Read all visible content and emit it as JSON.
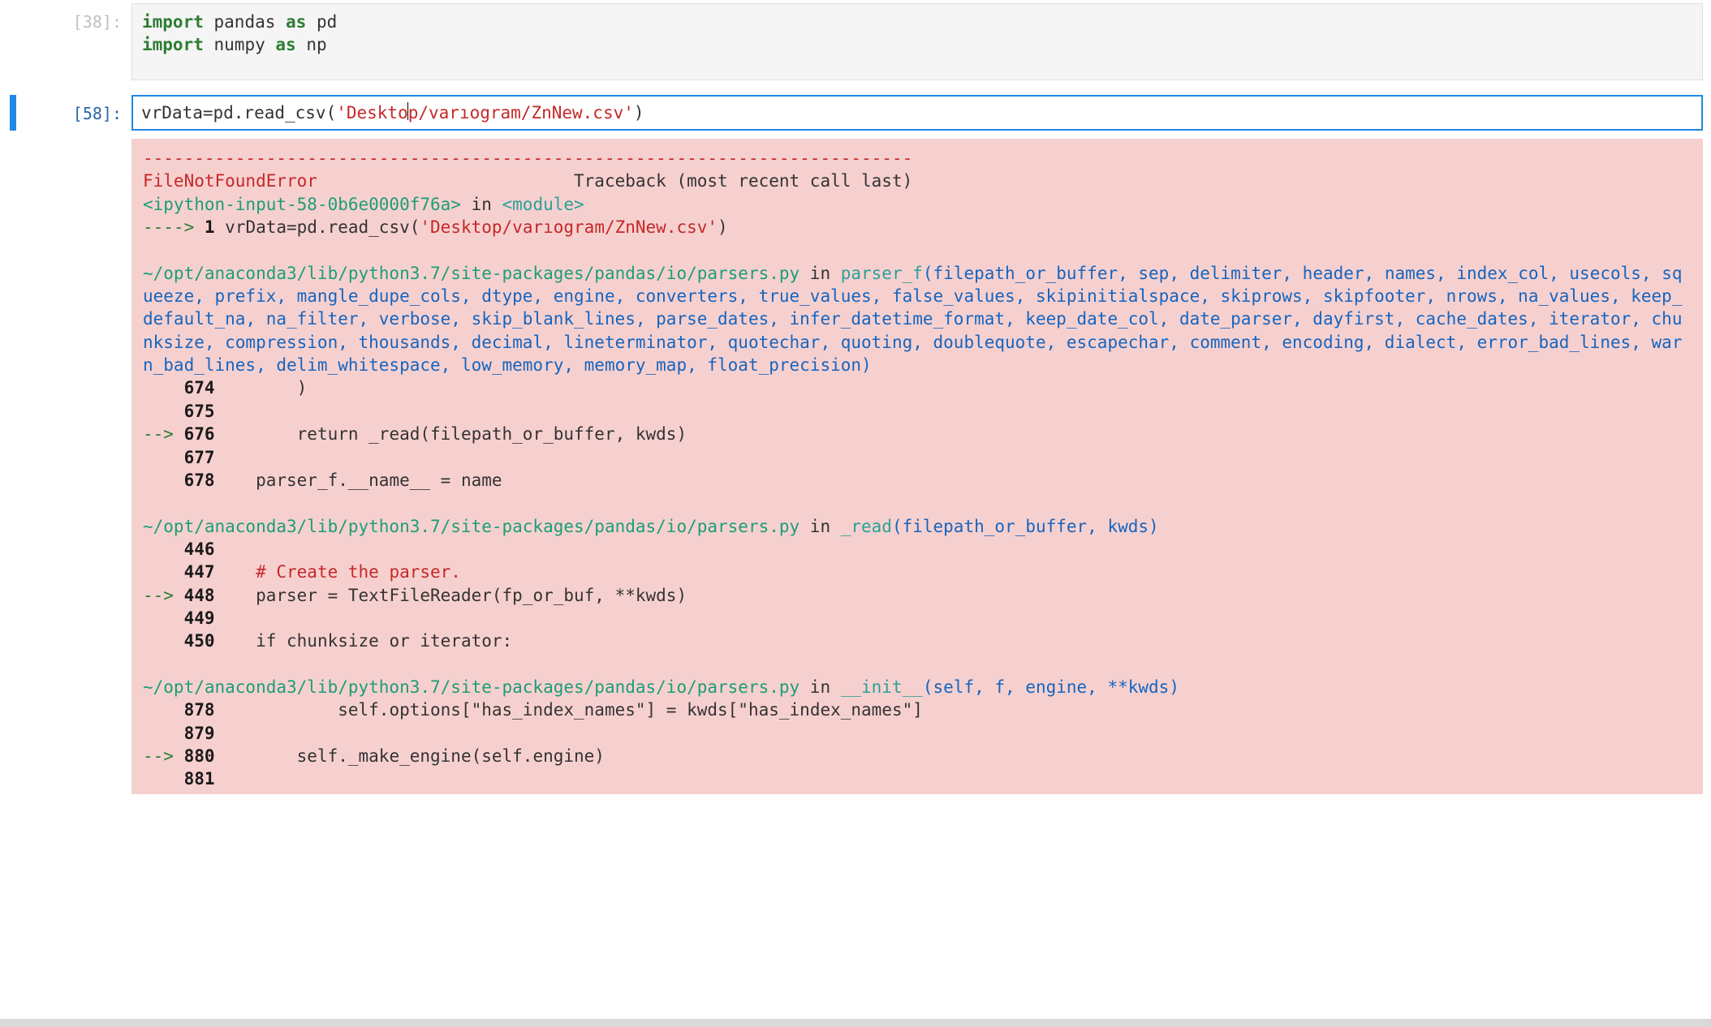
{
  "cells": {
    "imports": {
      "prompt": "[38]:",
      "line1": {
        "k1": "import",
        "mod": "pandas",
        "k2": "as",
        "alias": "pd"
      },
      "line2": {
        "k1": "import",
        "mod": "numpy",
        "k2": "as",
        "alias": "np"
      }
    },
    "readcsv": {
      "prompt": "[58]:",
      "assign": "vrData=pd.read_csv(",
      "path_before_cursor": "'Deskto",
      "path_after_cursor": "p/varıogram/ZnNew.csv'",
      "close": ")"
    }
  },
  "traceback": {
    "sep": "---------------------------------------------------------------------------",
    "exc_name": "FileNotFoundError",
    "exc_tail": "Traceback (most recent call last)",
    "frame0_loc": "<ipython-input-58-0b6e0000f76a>",
    "frame0_in": " in ",
    "frame0_mod": "<module>",
    "frame0_arrow": "----> ",
    "frame0_ln": "1",
    "frame0_code_pre": " vrData=pd.read_csv(",
    "frame0_code_str": "'Desktop/varıogram/ZnNew.csv'",
    "frame0_code_post": ")",
    "frame1_path": "~/opt/anaconda3/lib/python3.7/site-packages/pandas/io/parsers.py",
    "frame1_in": " in ",
    "frame1_fn": "parser_f",
    "frame1_sig": "(filepath_or_buffer, sep, delimiter, header, names, index_col, usecols, squeeze, prefix, mangle_dupe_cols, dtype, engine, converters, true_values, false_values, skipinitialspace, skiprows, skipfooter, nrows, na_values, keep_default_na, na_filter, verbose, skip_blank_lines, parse_dates, infer_datetime_format, keep_date_col, date_parser, dayfirst, cache_dates, iterator, chunksize, compression, thousands, decimal, lineterminator, quotechar, quoting, doublequote, escapechar, comment, encoding, dialect, error_bad_lines, warn_bad_lines, delim_whitespace, low_memory, memory_map, float_precision)",
    "frame1_lines": {
      "l674": {
        "ln": "674",
        "code": "        )"
      },
      "l675": {
        "ln": "675",
        "code": ""
      },
      "l676": {
        "arrow": "--> ",
        "ln": "676",
        "code": "        return _read(filepath_or_buffer, kwds)"
      },
      "l677": {
        "ln": "677",
        "code": ""
      },
      "l678": {
        "ln": "678",
        "code": "    parser_f.__name__ = name"
      }
    },
    "frame2_path": "~/opt/anaconda3/lib/python3.7/site-packages/pandas/io/parsers.py",
    "frame2_in": " in ",
    "frame2_fn": "_read",
    "frame2_sig": "(filepath_or_buffer, kwds)",
    "frame2_lines": {
      "l446": {
        "ln": "446",
        "code": ""
      },
      "l447": {
        "ln": "447",
        "code": "    ",
        "comment": "# Create the parser."
      },
      "l448": {
        "arrow": "--> ",
        "ln": "448",
        "code": "    parser = TextFileReader(fp_or_buf, **kwds)"
      },
      "l449": {
        "ln": "449",
        "code": ""
      },
      "l450": {
        "ln": "450",
        "code": "    if chunksize or iterator:"
      }
    },
    "frame3_path": "~/opt/anaconda3/lib/python3.7/site-packages/pandas/io/parsers.py",
    "frame3_in": " in ",
    "frame3_fn": "__init__",
    "frame3_sig": "(self, f, engine, **kwds)",
    "frame3_lines": {
      "l878": {
        "ln": "878",
        "code": "            self.options[\"has_index_names\"] = kwds[\"has_index_names\"]"
      },
      "l879": {
        "ln": "879",
        "code": ""
      },
      "l880": {
        "arrow": "--> ",
        "ln": "880",
        "code": "        self._make_engine(self.engine)"
      },
      "l881": {
        "ln": "881",
        "code": ""
      }
    }
  }
}
